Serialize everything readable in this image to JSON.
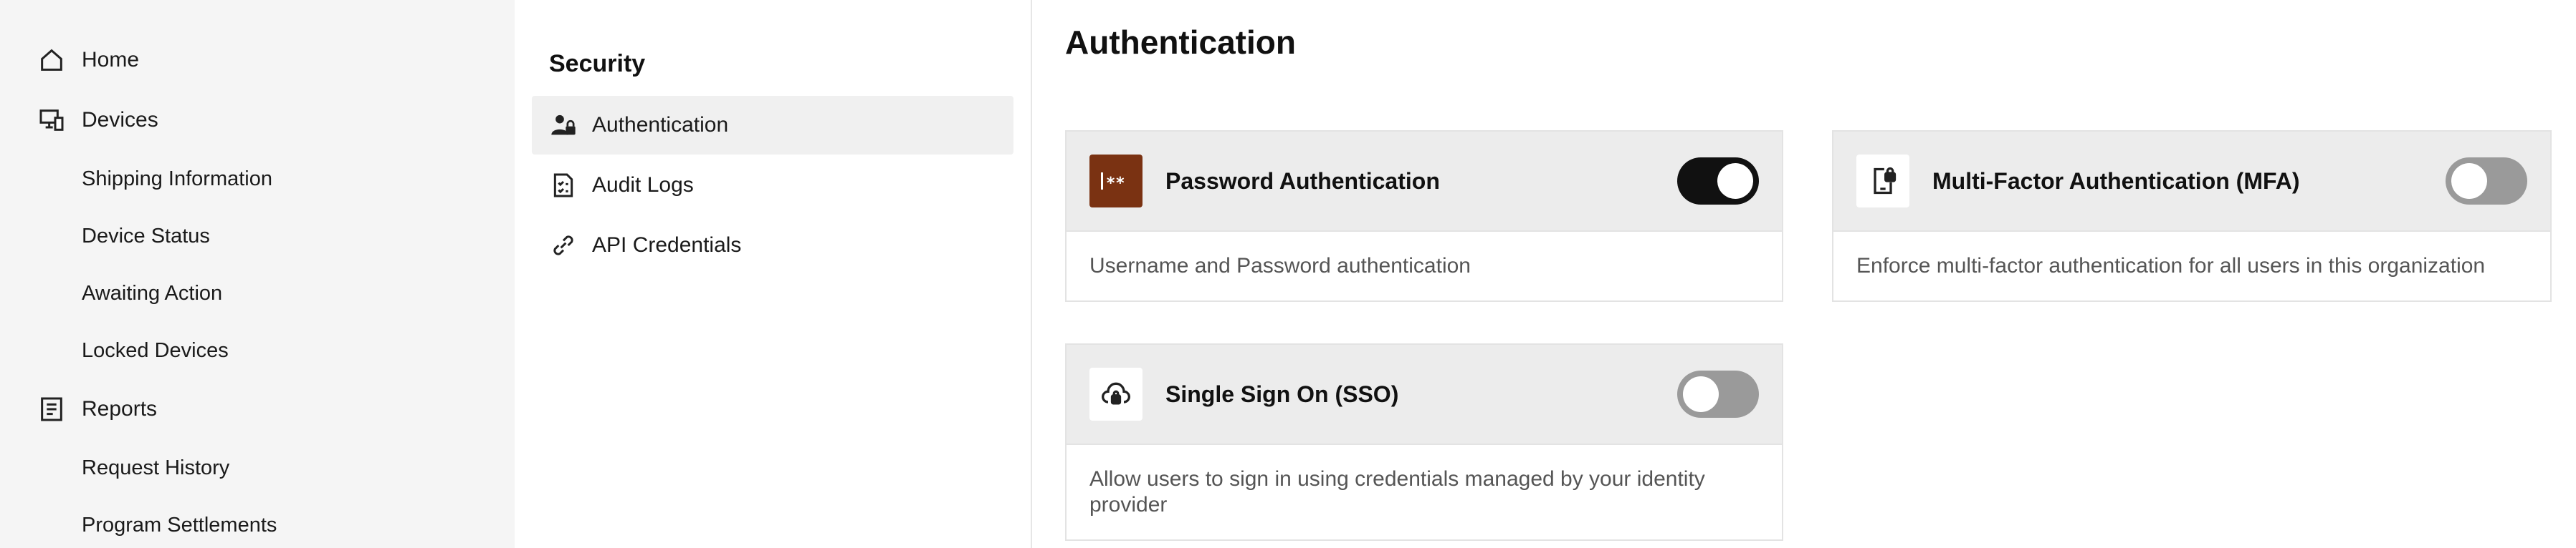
{
  "nav": {
    "home": "Home",
    "devices": "Devices",
    "devices_sub": [
      "Shipping Information",
      "Device Status",
      "Awaiting Action",
      "Locked Devices"
    ],
    "reports": "Reports",
    "reports_sub": [
      "Request History",
      "Program Settlements"
    ]
  },
  "security_menu": {
    "title": "Security",
    "items": [
      {
        "label": "Authentication",
        "icon": "user-lock-icon",
        "active": true
      },
      {
        "label": "Audit Logs",
        "icon": "document-check-icon",
        "active": false
      },
      {
        "label": "API Credentials",
        "icon": "link-icon",
        "active": false
      }
    ]
  },
  "main": {
    "title": "Authentication",
    "cards": [
      {
        "title": "Password Authentication",
        "description": "Username and Password authentication",
        "enabled": true,
        "icon": "password-icon"
      },
      {
        "title": "Multi-Factor Authentication (MFA)",
        "description": "Enforce multi-factor authentication for all users in this organization",
        "enabled": false,
        "icon": "mfa-device-icon"
      },
      {
        "title": "Single Sign On (SSO)",
        "description": "Allow users to sign in using credentials managed by your identity provider",
        "enabled": false,
        "icon": "cloud-lock-icon"
      }
    ]
  },
  "colors": {
    "sidebar_bg": "#f5f5f5",
    "card_header_bg": "#ececec",
    "password_icon_bg": "#7a3212",
    "toggle_on": "#111111",
    "toggle_off": "#9a9a9a"
  }
}
